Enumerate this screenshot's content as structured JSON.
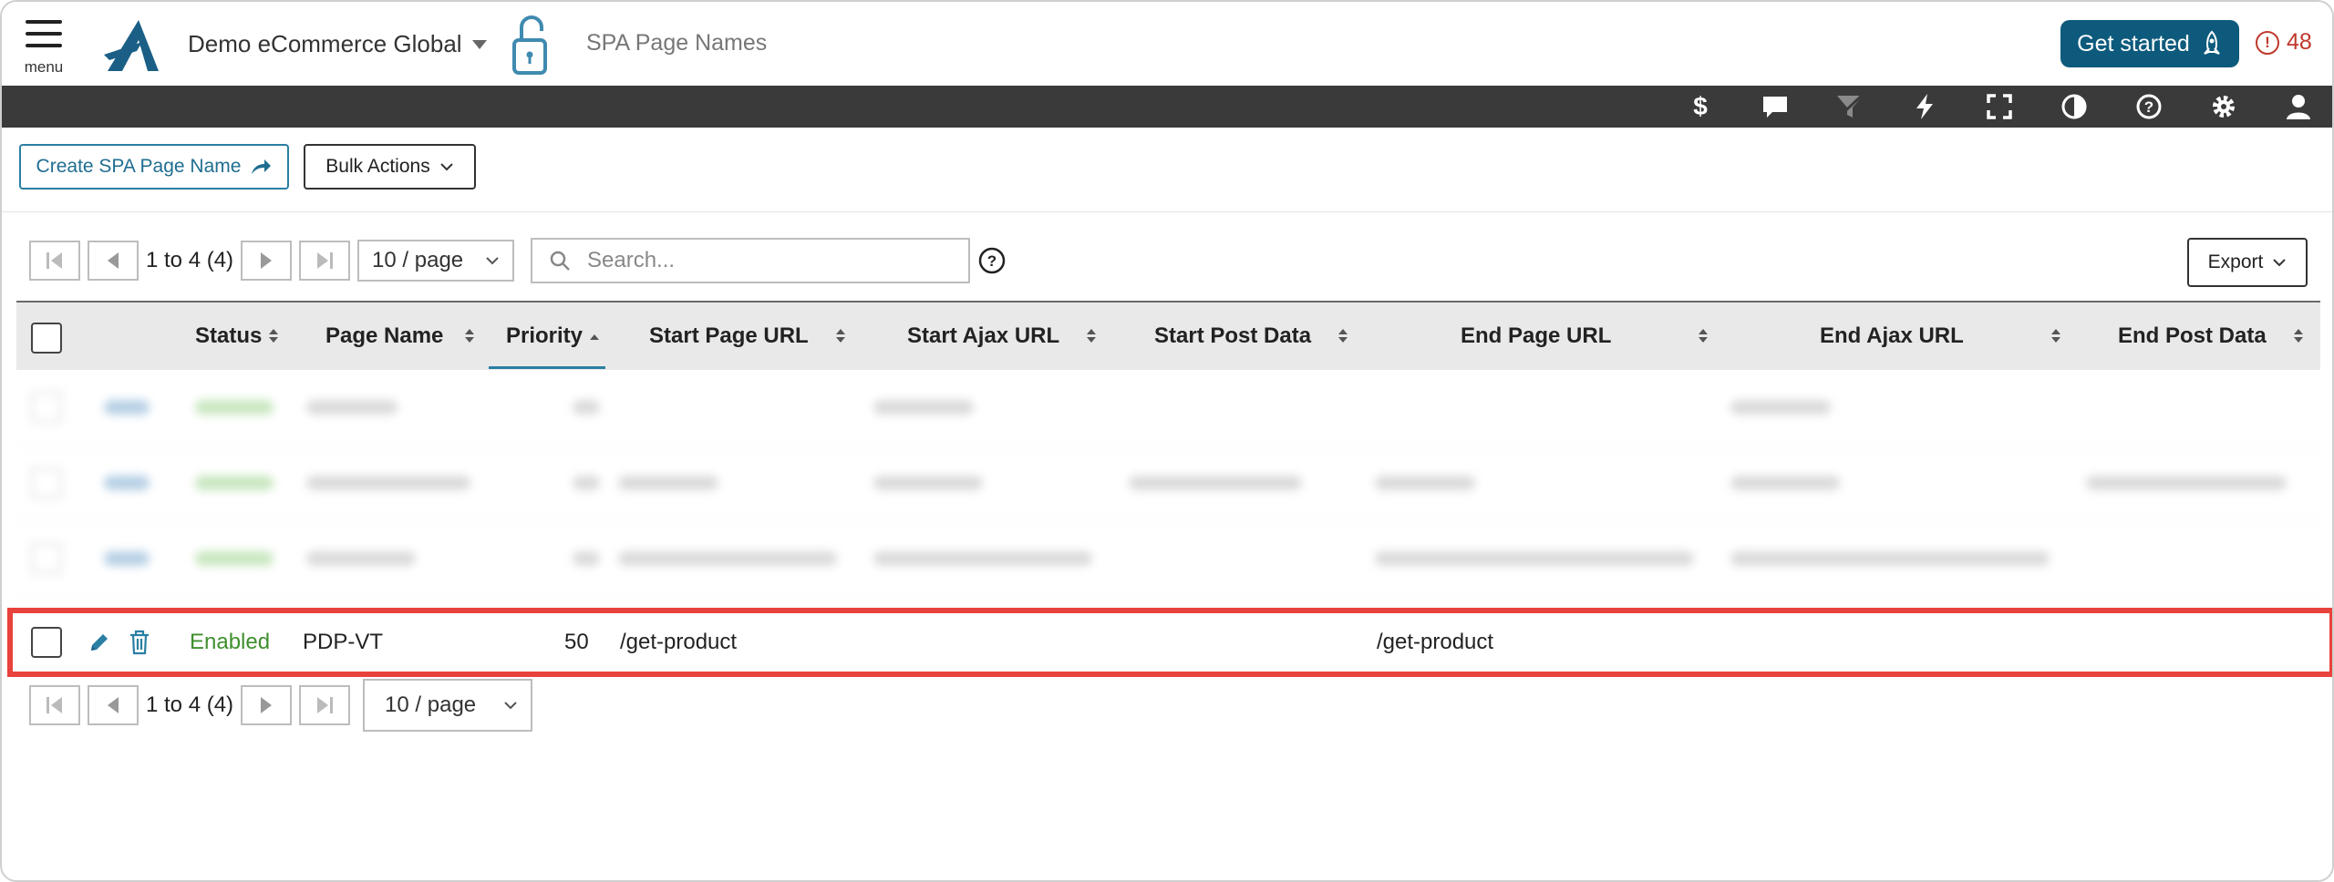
{
  "header": {
    "menu_label": "menu",
    "app_name": "Demo eCommerce Global",
    "page_title": "SPA Page Names",
    "get_started_label": "Get started",
    "alert_count": "48"
  },
  "toolbar": {
    "icons": [
      "dollar-icon",
      "comment-icon",
      "filter-icon",
      "lightning-icon",
      "fullscreen-icon",
      "contrast-icon",
      "help-icon",
      "gear-icon",
      "user-icon"
    ]
  },
  "actions": {
    "create_label": "Create SPA Page Name",
    "bulk_label": "Bulk Actions"
  },
  "pager": {
    "range_text": "1 to 4 (4)",
    "per_page": "10 / page"
  },
  "search": {
    "placeholder": "Search..."
  },
  "export_label": "Export",
  "table": {
    "columns": [
      "Status",
      "Page Name",
      "Priority",
      "Start Page URL",
      "Start Ajax URL",
      "Start Post Data",
      "End Page URL",
      "End Ajax URL",
      "End Post Data"
    ],
    "visible_row": {
      "status": "Enabled",
      "page_name": "PDP-VT",
      "priority": "50",
      "start_page_url": "/get-product",
      "start_ajax_url": "",
      "start_post_data": "",
      "end_page_url": "/get-product",
      "end_ajax_url": "",
      "end_post_data": ""
    }
  },
  "colors": {
    "accent": "#0d5a7c",
    "toolbar_bg": "#3a3a3a",
    "enabled_text": "#3f8f2e",
    "highlight_border": "#e8423c",
    "alert": "#c0392b"
  }
}
